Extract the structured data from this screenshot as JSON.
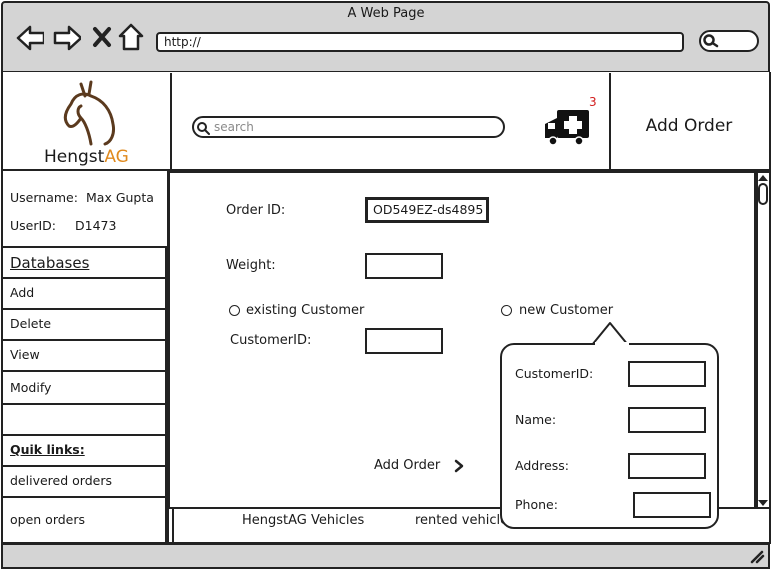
{
  "browser": {
    "title": "A Web Page",
    "url": "http://",
    "icons": [
      "back-arrow-icon",
      "forward-arrow-icon",
      "close-x-icon",
      "home-icon",
      "search-icon"
    ]
  },
  "header": {
    "logo_name_main": "Hengst",
    "logo_name_accent": "AG",
    "search_placeholder": "search",
    "cart_icon": "ambulance-icon",
    "notification_count": "3",
    "page_title": "Add Order",
    "accent_color": "#e08a1e",
    "badge_color": "#d21d1d"
  },
  "sidebar": {
    "username_label": "Username:",
    "username_value": "Max Gupta",
    "userid_label": "UserID:",
    "userid_value": "D1473",
    "section_title": "Databases",
    "items": [
      "Add",
      "Delete",
      "View",
      "Modify"
    ],
    "quick_links_title": "Quik links:",
    "quick_links": [
      "delivered orders",
      "open orders"
    ]
  },
  "form": {
    "order_id_label": "Order ID:",
    "order_id_value": "OD549EZ-ds4895",
    "weight_label": "Weight:",
    "weight_value": "",
    "existing_customer_label": "existing Customer",
    "new_customer_label": "new Customer",
    "customer_id_label": "CustomerID:",
    "customer_id_value": "",
    "submit_label": "Add Order",
    "submit_icon": "chevron-right-icon"
  },
  "popup": {
    "customer_id_label": "CustomerID:",
    "name_label": "Name:",
    "address_label": "Address:",
    "phone_label": "Phone:",
    "customer_id_value": "",
    "name_value": "",
    "address_value": "",
    "phone_value": ""
  },
  "footer": {
    "links": [
      "HengstAG Vehicles",
      "rented vehicles"
    ]
  }
}
